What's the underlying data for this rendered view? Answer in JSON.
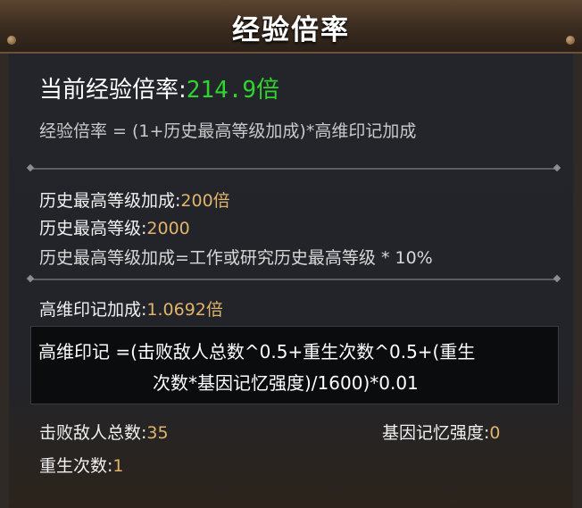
{
  "header": {
    "title": "经验倍率"
  },
  "current": {
    "label": "当前经验倍率:",
    "value": "214.9倍"
  },
  "formula": "经验倍率 = (1+历史最高等级加成)*高维印记加成",
  "history": {
    "bonus_label": "历史最高等级加成:",
    "bonus_value": "200倍",
    "level_label": "历史最高等级:",
    "level_value": "2000",
    "rule": "历史最高等级加成=工作或研究历史最高等级 * 10%"
  },
  "imprint": {
    "bonus_label": "高维印记加成:",
    "bonus_value": "1.0692倍",
    "formula_line1": "高维印记 =(击败敌人总数^0.5+重生次数^0.5+(重生",
    "formula_line2": "次数*基因记忆强度)/1600)*0.01"
  },
  "stats": {
    "kills_label": "击败敌人总数:",
    "kills_value": "35",
    "gene_label": "基因记忆强度:",
    "gene_value": "0",
    "rebirth_label": "重生次数:",
    "rebirth_value": "1"
  }
}
